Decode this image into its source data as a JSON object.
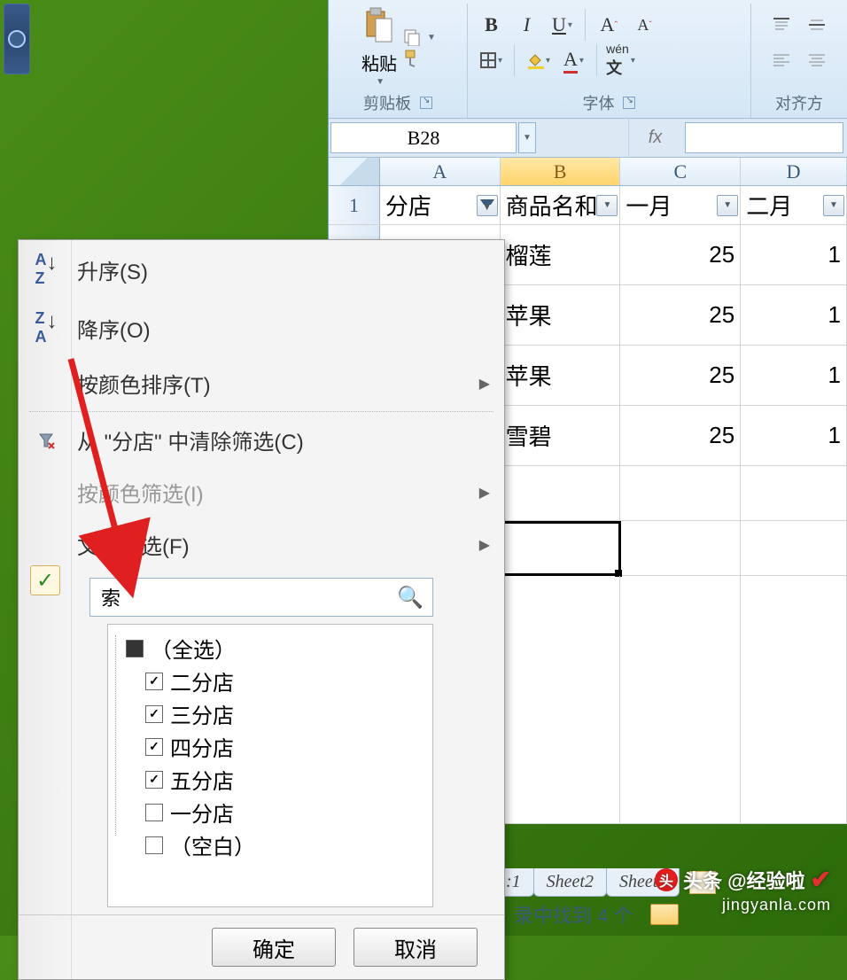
{
  "ribbon": {
    "paste_label": "粘贴",
    "clipboard_group": "剪贴板",
    "font_group": "字体",
    "align_group": "对齐方"
  },
  "formula": {
    "name_box": "B28",
    "fx": "fx"
  },
  "columns": [
    "A",
    "B",
    "C",
    "D"
  ],
  "header_row_num": "1",
  "headers": {
    "a": "分店",
    "b": "商品名和",
    "c": "一月",
    "d": "二月"
  },
  "rows": [
    {
      "b": "榴莲",
      "c": "25",
      "d": "1"
    },
    {
      "b": "苹果",
      "c": "25",
      "d": "1"
    },
    {
      "b": "苹果",
      "c": "25",
      "d": "1"
    },
    {
      "b": "雪碧",
      "c": "25",
      "d": "1"
    }
  ],
  "filter_menu": {
    "sort_asc": "升序(S)",
    "sort_desc": "降序(O)",
    "sort_by_color": "按颜色排序(T)",
    "clear_filter": "从 \"分店\" 中清除筛选(C)",
    "filter_by_color": "按颜色筛选(I)",
    "text_filter": "文本筛选(F)",
    "search_placeholder": "索",
    "select_all": "（全选）",
    "options": [
      {
        "label": "二分店",
        "checked": true
      },
      {
        "label": "三分店",
        "checked": true
      },
      {
        "label": "四分店",
        "checked": true
      },
      {
        "label": "五分店",
        "checked": true
      },
      {
        "label": "一分店",
        "checked": false
      },
      {
        "label": "（空白）",
        "checked": false
      }
    ],
    "ok": "确定",
    "cancel": "取消"
  },
  "sheets": {
    "s1_partial": ":1",
    "s2": "Sheet2",
    "s3": "Sheet3"
  },
  "status": "录中找到 4 个",
  "watermark": {
    "top": "头条 @经验啦",
    "bottom": "jingyanla.com"
  }
}
